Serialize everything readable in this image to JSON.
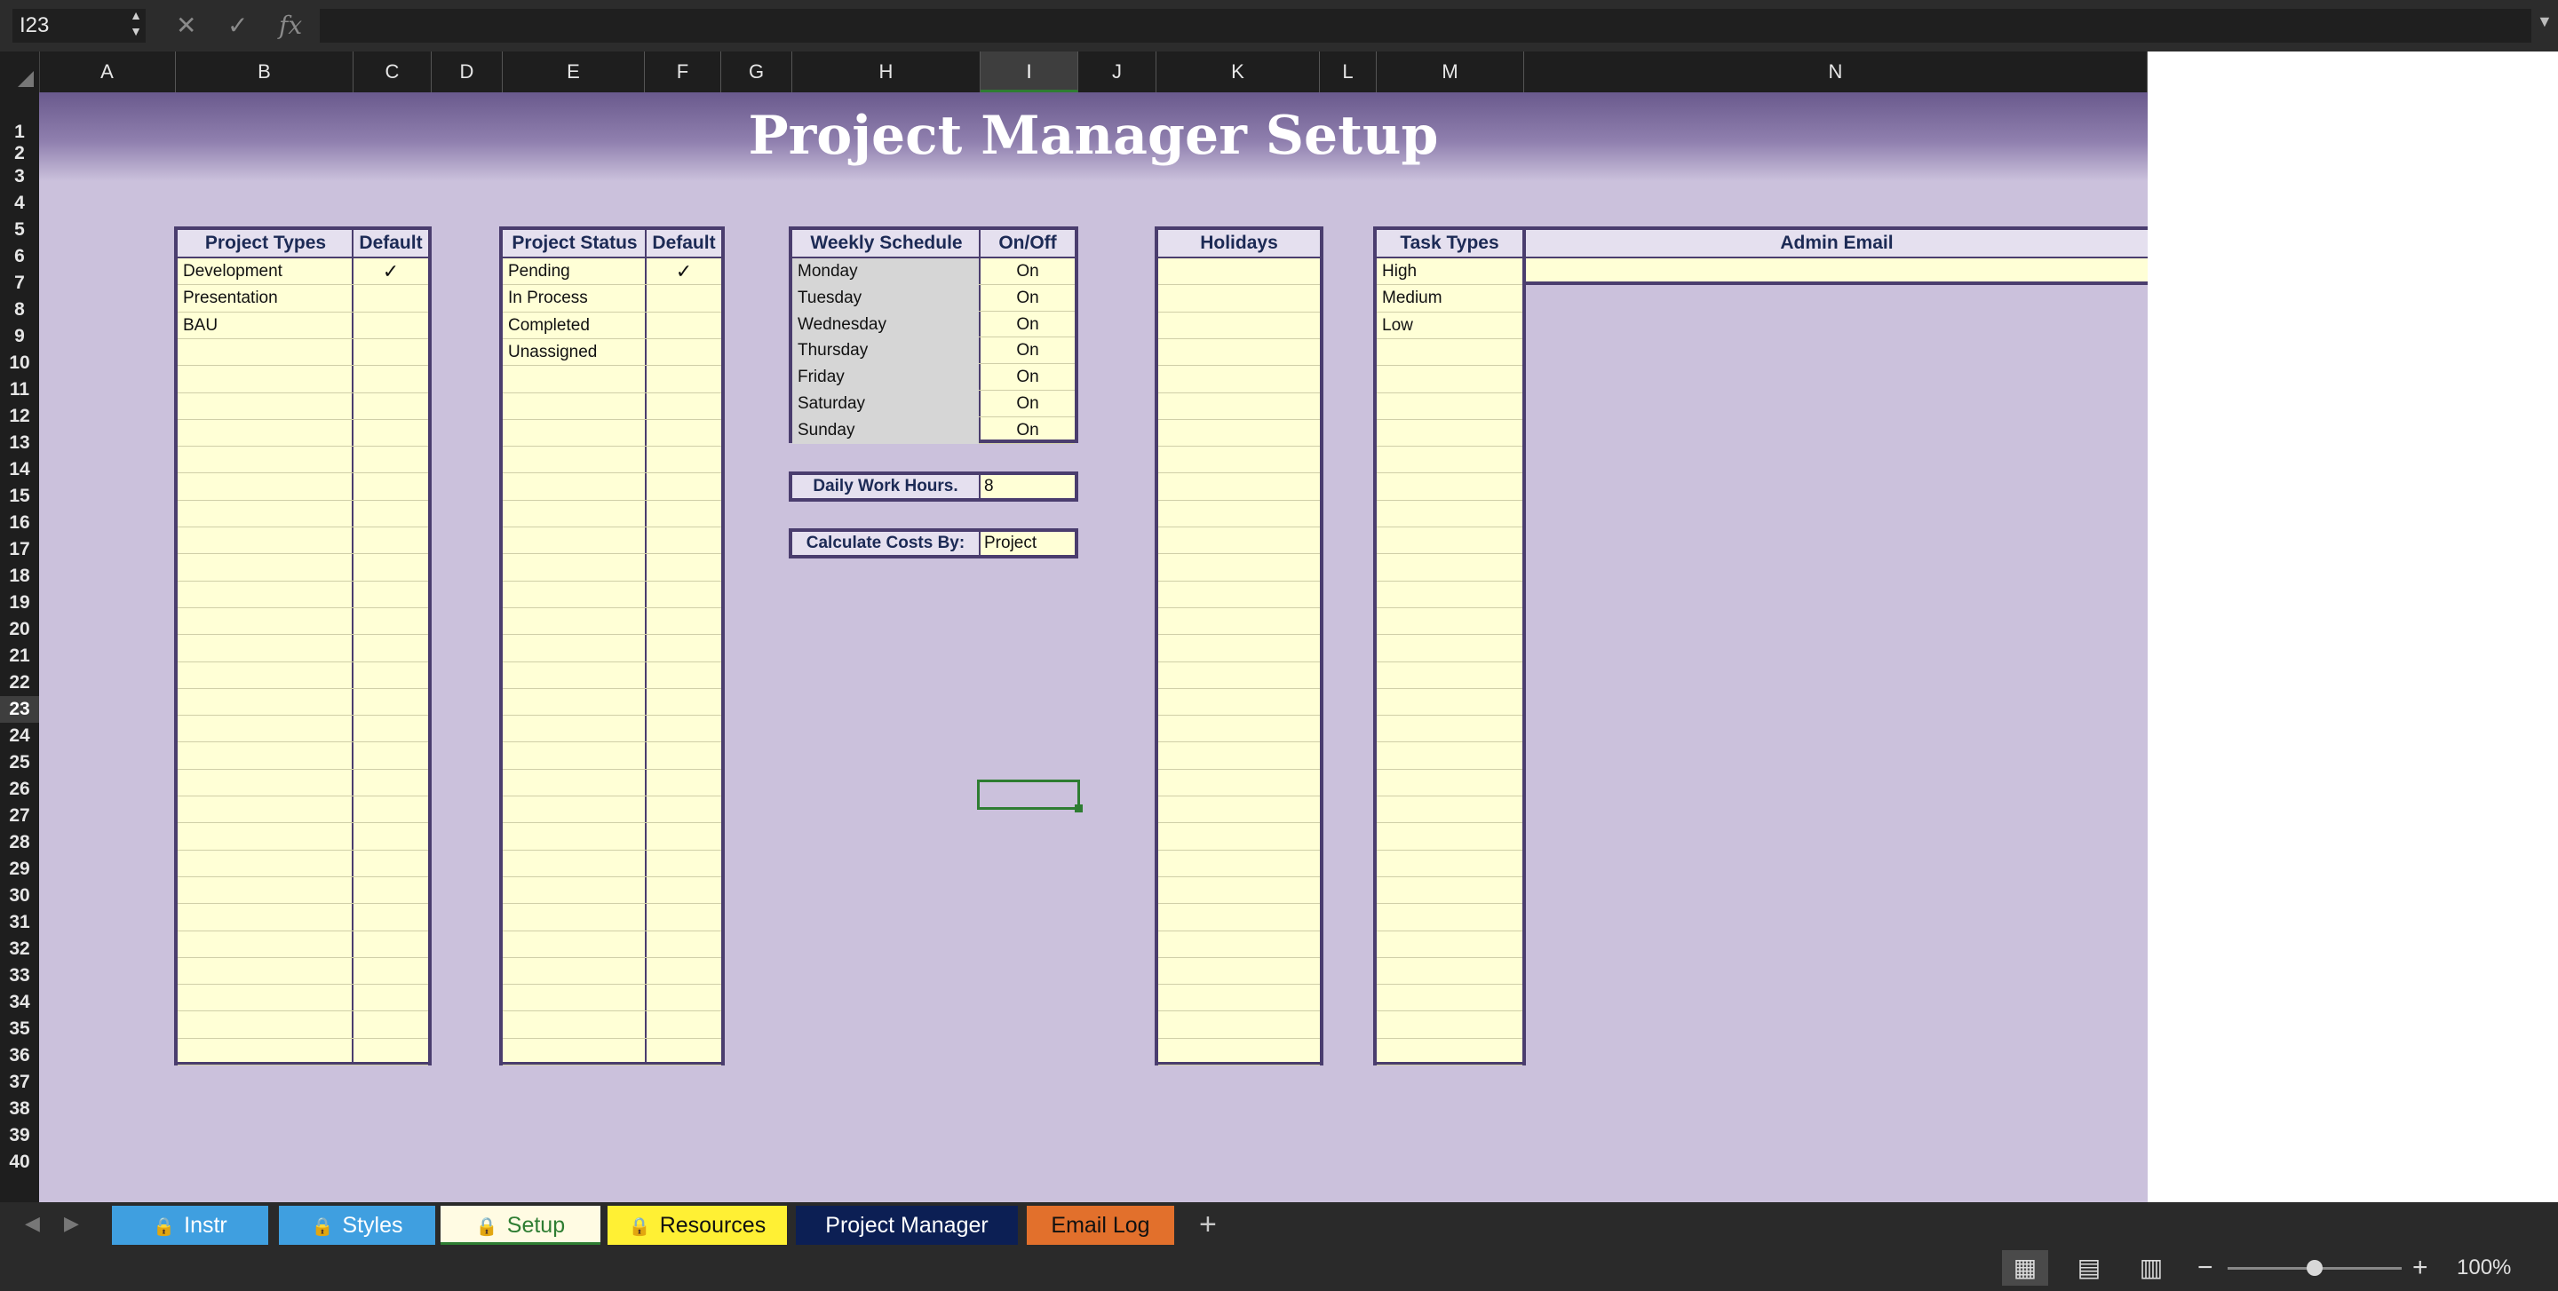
{
  "formula_bar": {
    "cell_reference": "I23",
    "cancel_icon": "✕",
    "enter_icon": "✓",
    "fx_label": "fx",
    "formula_value": ""
  },
  "columns": [
    "A",
    "B",
    "C",
    "D",
    "E",
    "F",
    "G",
    "H",
    "I",
    "J",
    "K",
    "L",
    "M",
    "N"
  ],
  "active_column": "I",
  "rows": [
    "1",
    "2",
    "3",
    "4",
    "5",
    "6",
    "7",
    "8",
    "9",
    "10",
    "11",
    "12",
    "13",
    "14",
    "15",
    "16",
    "17",
    "18",
    "19",
    "20",
    "21",
    "22",
    "23",
    "24",
    "25",
    "26",
    "27",
    "28",
    "29",
    "30",
    "31",
    "32",
    "33",
    "34",
    "35",
    "36",
    "37",
    "38",
    "39",
    "40"
  ],
  "active_row": "23",
  "sheet": {
    "title": "Project Manager Setup",
    "project_types": {
      "header": "Project Types",
      "default_header": "Default",
      "items": [
        "Development",
        "Presentation",
        "BAU"
      ],
      "defaults": [
        "✓",
        "",
        ""
      ]
    },
    "project_status": {
      "header": "Project Status",
      "default_header": "Default",
      "items": [
        "Pending",
        "In Process",
        "Completed",
        "Unassigned"
      ],
      "defaults": [
        "✓",
        "",
        "",
        ""
      ]
    },
    "weekly_schedule": {
      "header": "Weekly Schedule",
      "onoff_header": "On/Off",
      "days": [
        "Monday",
        "Tuesday",
        "Wednesday",
        "Thursday",
        "Friday",
        "Saturday",
        "Sunday"
      ],
      "values": [
        "On",
        "On",
        "On",
        "On",
        "On",
        "On",
        "On"
      ]
    },
    "daily_work_hours": {
      "label": "Daily Work Hours.",
      "value": "8"
    },
    "calculate_costs_by": {
      "label": "Calculate Costs By:",
      "value": "Project"
    },
    "holidays": {
      "header": "Holidays",
      "items": []
    },
    "task_types": {
      "header": "Task Types",
      "items": [
        "High",
        "Medium",
        "Low"
      ]
    },
    "admin_email": {
      "header": "Admin Email",
      "value": ""
    }
  },
  "sheet_tabs": [
    {
      "label": "Instr",
      "locked": true,
      "bg": "#3f9fe0",
      "fg": "#ffffff"
    },
    {
      "label": "Styles",
      "locked": true,
      "bg": "#3f9fe0",
      "fg": "#ffffff"
    },
    {
      "label": "Setup",
      "locked": true,
      "bg": "#fffbe3",
      "fg": "#2e7d32",
      "active": true
    },
    {
      "label": "Resources",
      "locked": true,
      "bg": "#fff034",
      "fg": "#111111"
    },
    {
      "label": "Project Manager",
      "locked": false,
      "bg": "#0c1f54",
      "fg": "#ffffff"
    },
    {
      "label": "Email Log",
      "locked": false,
      "bg": "#e2702c",
      "fg": "#111111"
    }
  ],
  "add_sheet_label": "+",
  "status_bar": {
    "zoom_level": "100%",
    "zoom_fraction": 0.5,
    "views": [
      "normal-view",
      "page-layout-view",
      "page-break-view"
    ]
  },
  "colors": {
    "sheet_bg": "#cbc1dc",
    "table_border": "#4a3d6e",
    "input_cell": "#ffffd6",
    "header_text": "#1c2a55",
    "selection": "#2e7d32"
  }
}
